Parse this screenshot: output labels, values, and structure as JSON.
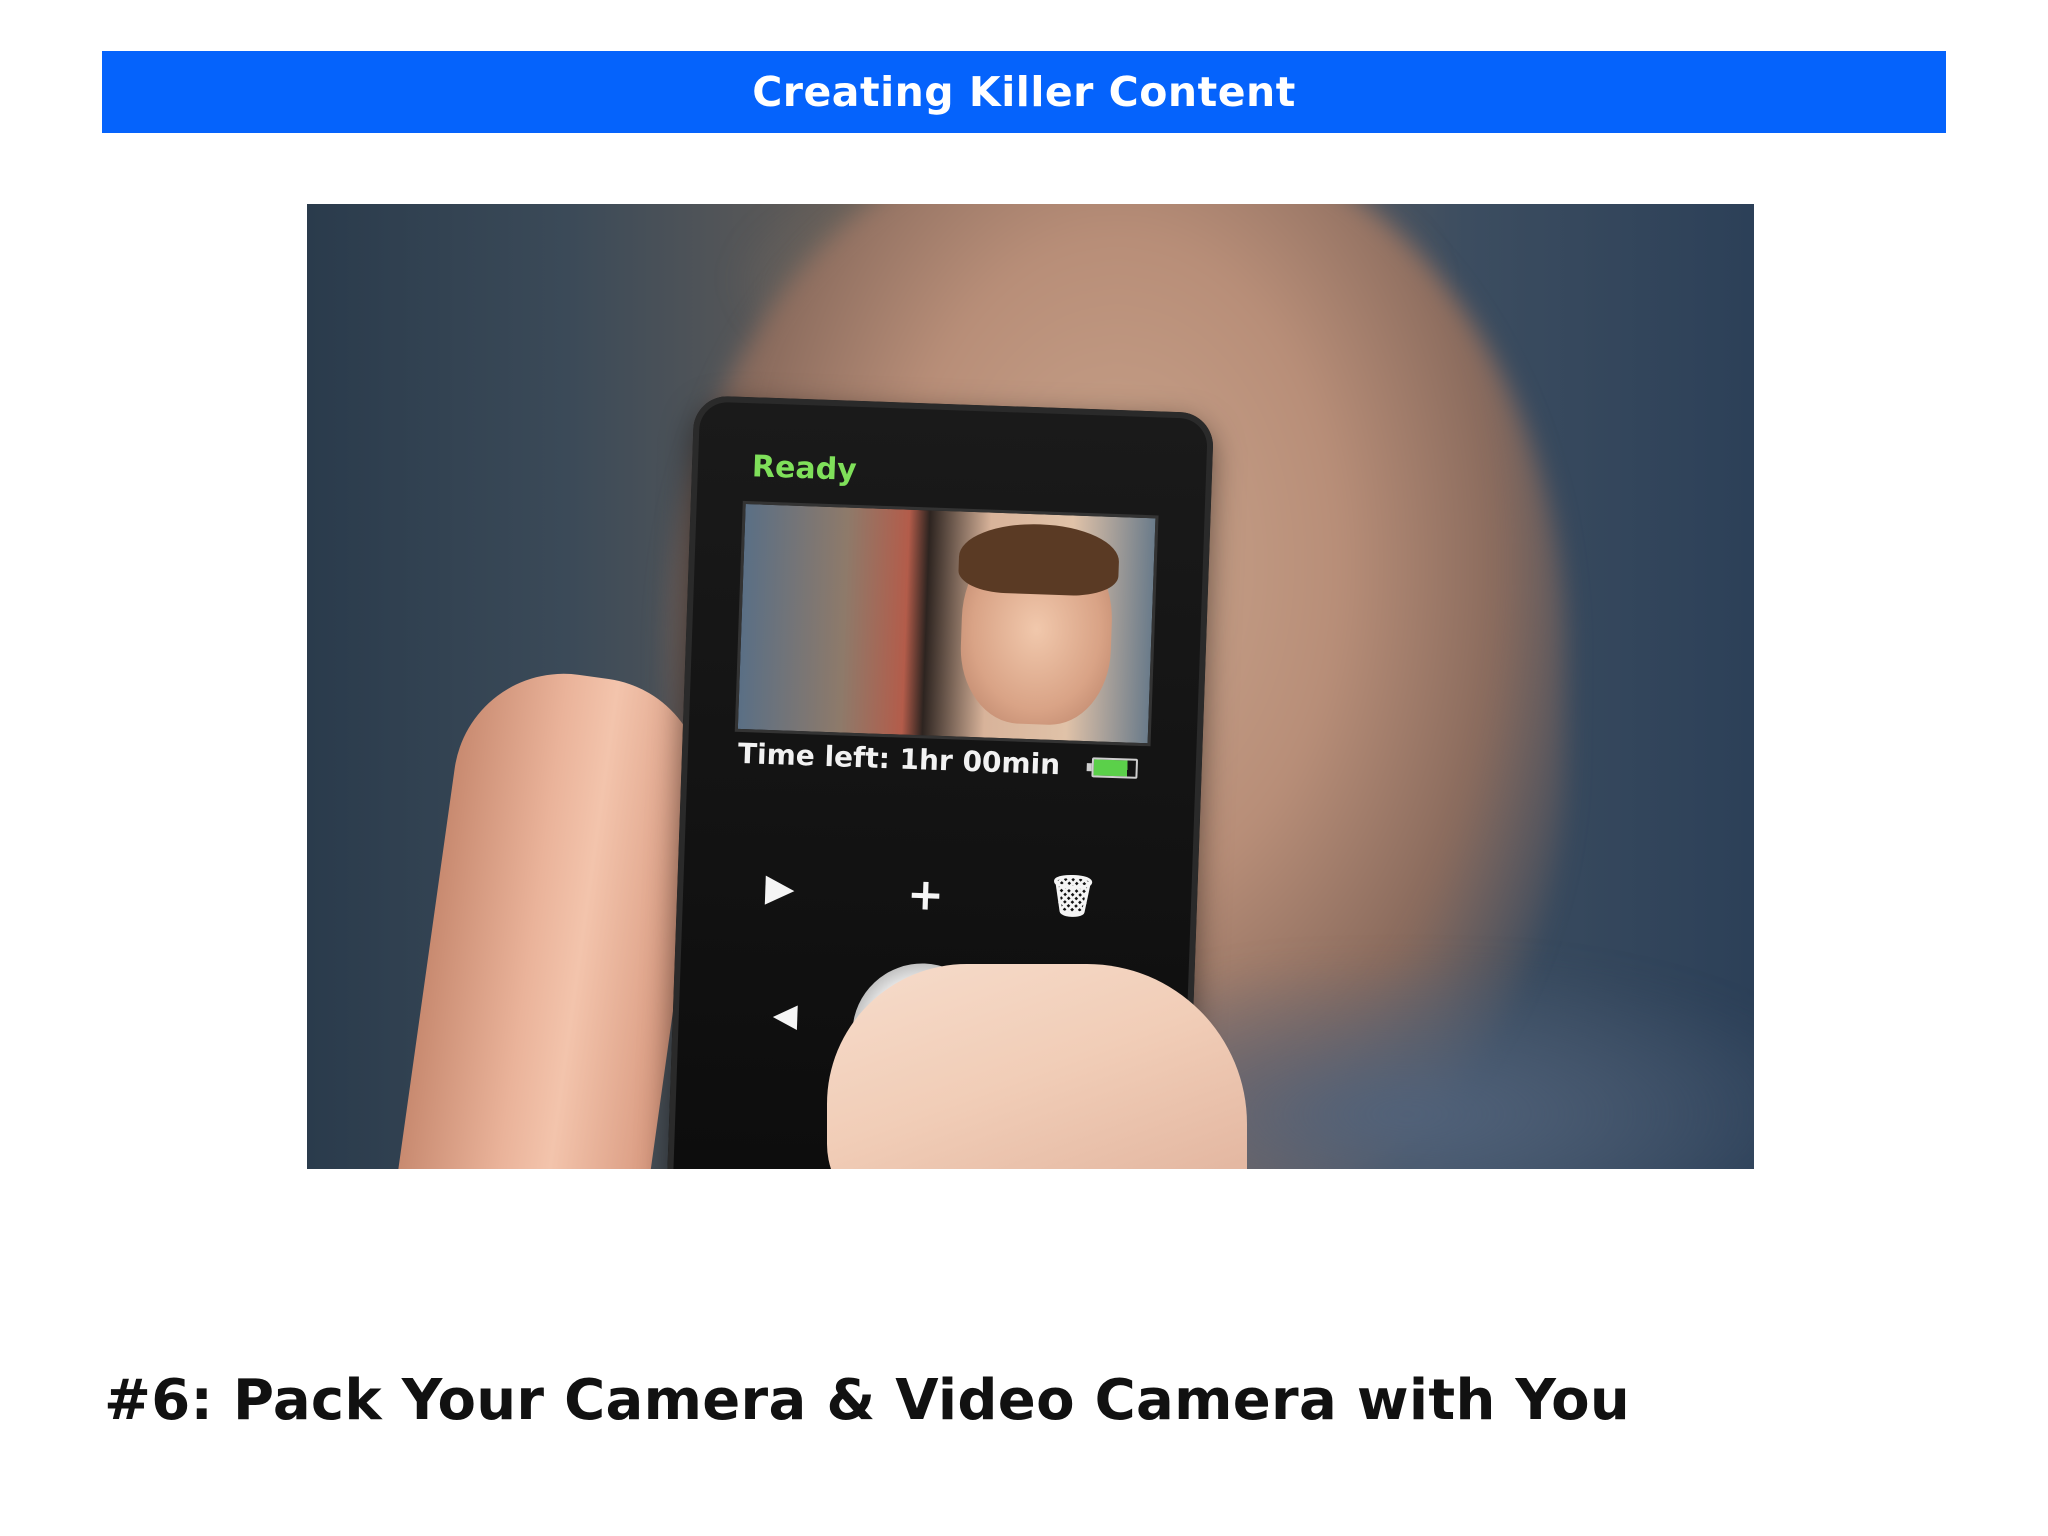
{
  "header": {
    "title": "Creating Killer Content"
  },
  "photo": {
    "device_status": "Ready",
    "device_time": "Time left: 1hr 00min",
    "icons": [
      "play-icon",
      "plus-icon",
      "trash-icon",
      "back-icon",
      "battery-icon"
    ],
    "record_color": "#e01a10"
  },
  "caption": "#6: Pack Your Camera & Video Camera with You",
  "colors": {
    "header_bar": "#0563fc",
    "header_text": "#ffffff",
    "caption_text": "#111111"
  }
}
